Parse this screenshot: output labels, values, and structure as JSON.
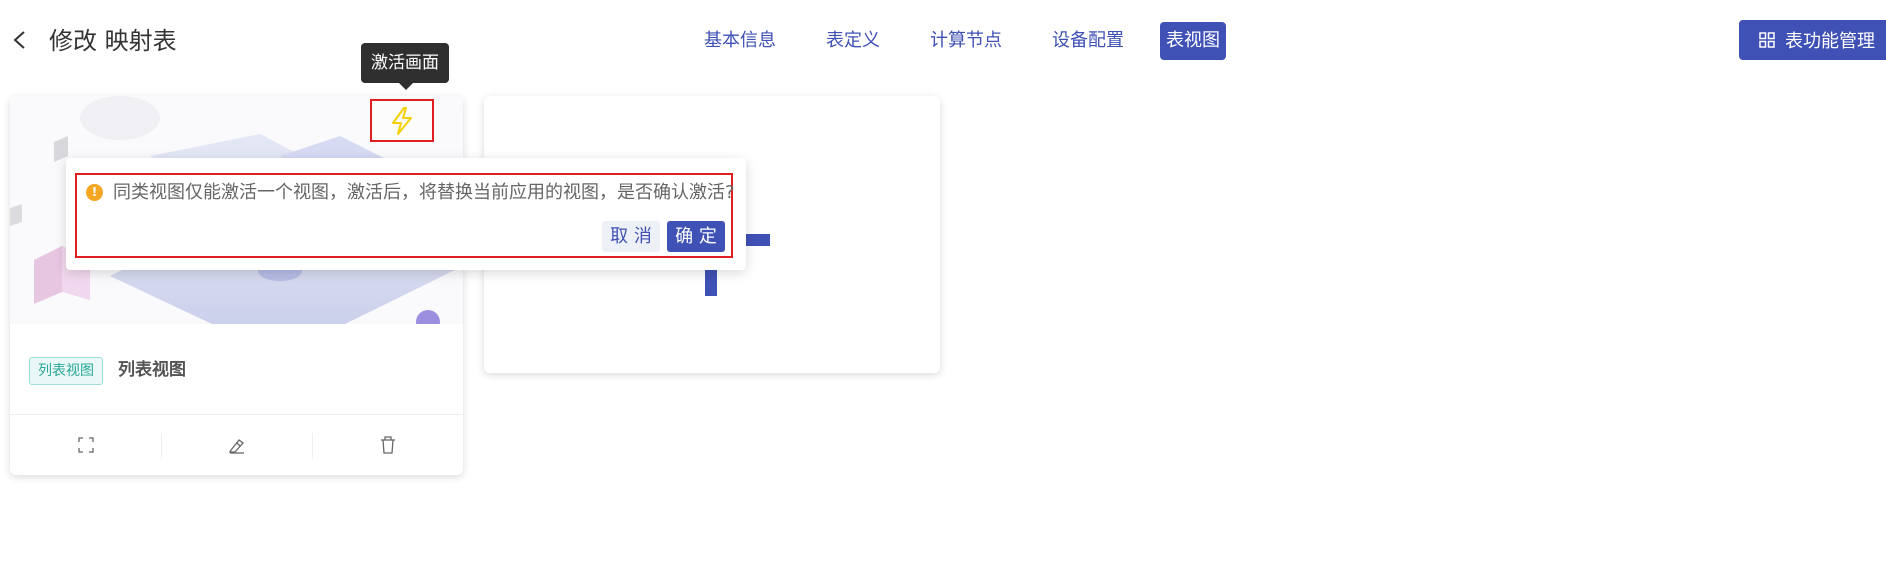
{
  "header": {
    "title": "修改 映射表",
    "tabs": [
      {
        "label": "基本信息"
      },
      {
        "label": "表定义"
      },
      {
        "label": "计算节点"
      },
      {
        "label": "设备配置"
      },
      {
        "label": "表视图",
        "active": true
      }
    ],
    "function_button_label": "表功能管理"
  },
  "view_card": {
    "tag": "列表视图",
    "name": "列表视图",
    "activate_tooltip": "激活画面",
    "actions": [
      "expand-icon",
      "edit-icon",
      "delete-icon"
    ]
  },
  "popconfirm": {
    "message": "同类视图仅能激活一个视图，激活后，将替换当前应用的视图，是否确认激活?",
    "cancel_label": "取 消",
    "ok_label": "确 定"
  },
  "colors": {
    "primary": "#3f51b5",
    "warning": "#f5a623",
    "highlight_border": "#e02020",
    "tag_text": "#2aa798",
    "activate_icon": "#f5d000"
  }
}
